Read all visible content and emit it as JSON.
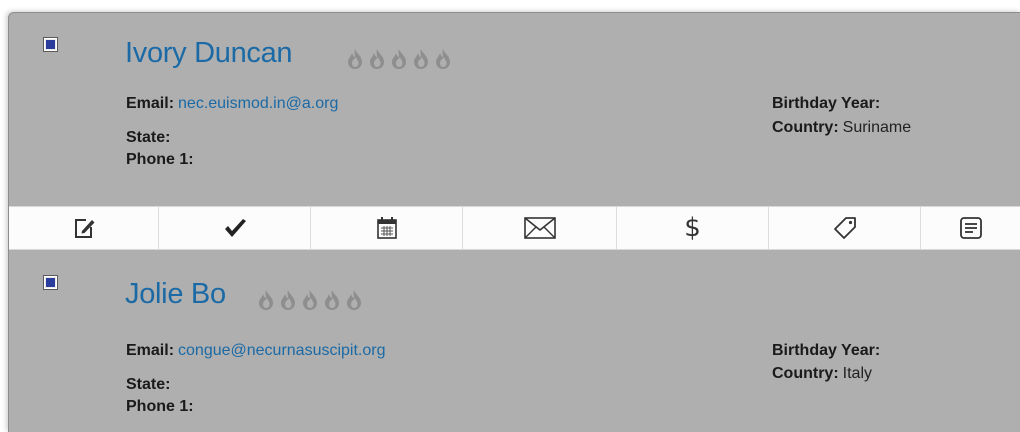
{
  "contacts": [
    {
      "name": "Ivory Duncan",
      "checked": true,
      "rating_flames": 5,
      "email_label": "Email:",
      "email": "nec.euismod.in@a.org",
      "state_label": "State:",
      "state": "",
      "phone1_label": "Phone 1:",
      "phone1": "",
      "birthday_label": "Birthday Year:",
      "birthday": "",
      "country_label": "Country:",
      "country": "Suriname"
    },
    {
      "name": "Jolie Bo",
      "checked": true,
      "rating_flames": 5,
      "email_label": "Email:",
      "email": "congue@necurnasuscipit.org",
      "state_label": "State:",
      "state": "",
      "phone1_label": "Phone 1:",
      "phone1": "",
      "birthday_label": "Birthday Year:",
      "birthday": "",
      "country_label": "Country:",
      "country": "Italy"
    }
  ],
  "toolbar": {
    "icons": [
      "edit-icon",
      "checkmark-icon",
      "calendar-icon",
      "envelope-icon",
      "dollar-icon",
      "tag-icon",
      "notes-icon"
    ],
    "dollar_symbol": "$"
  },
  "colors": {
    "card_background": "#afafaf",
    "name_link": "#1b6aa6",
    "flame": "#8e8e8e",
    "toolbar_background": "#fcfcfc",
    "checkbox_fill": "#2a3c9c"
  }
}
